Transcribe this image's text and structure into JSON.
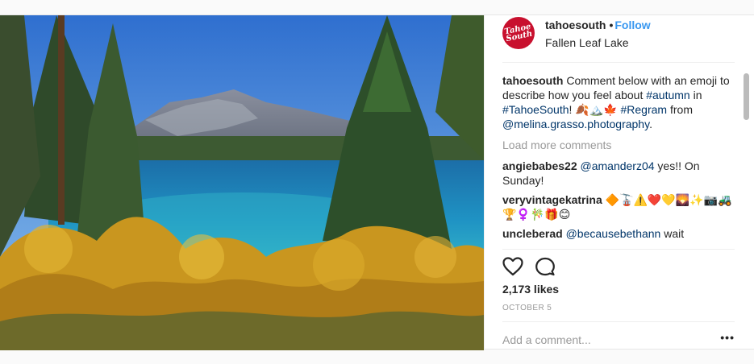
{
  "post": {
    "username": "tahoesouth",
    "separator": "•",
    "follow_label": "Follow",
    "location": "Fallen Leaf Lake",
    "avatar_text": "Tahoe South",
    "accent_color": "#3897f0",
    "brand_color": "#c8102e"
  },
  "caption": {
    "username": "tahoesouth",
    "text_1": " Comment below with an emoji to describe how you feel about ",
    "hashtag_1": "#autumn",
    "text_2": " in ",
    "hashtag_2": "#TahoeSouth",
    "text_3": "! 🍂🏔️🍁 ",
    "hashtag_3": "#Regram",
    "text_4": " from ",
    "mention": "@melina.grasso.photography",
    "text_5": "."
  },
  "load_more_label": "Load more comments",
  "comments": [
    {
      "username": "angiebabes22",
      "mention": "@amanderz04",
      "text": " yes!! On Sunday!"
    },
    {
      "username": "veryvintagekatrina",
      "mention": "",
      "text": " 🔶🚡⚠️❤️💛🌄✨📷🚜 🏆♀️🎋🎁😊"
    },
    {
      "username": "uncleberad",
      "mention": "@becausebethann",
      "text": " wait"
    }
  ],
  "likes": "2,173 likes",
  "date": "OCTOBER 5",
  "add_comment_placeholder": "Add a comment...",
  "more_label": "•••",
  "icons": {
    "like": "heart-icon",
    "comment": "comment-bubble-icon"
  }
}
